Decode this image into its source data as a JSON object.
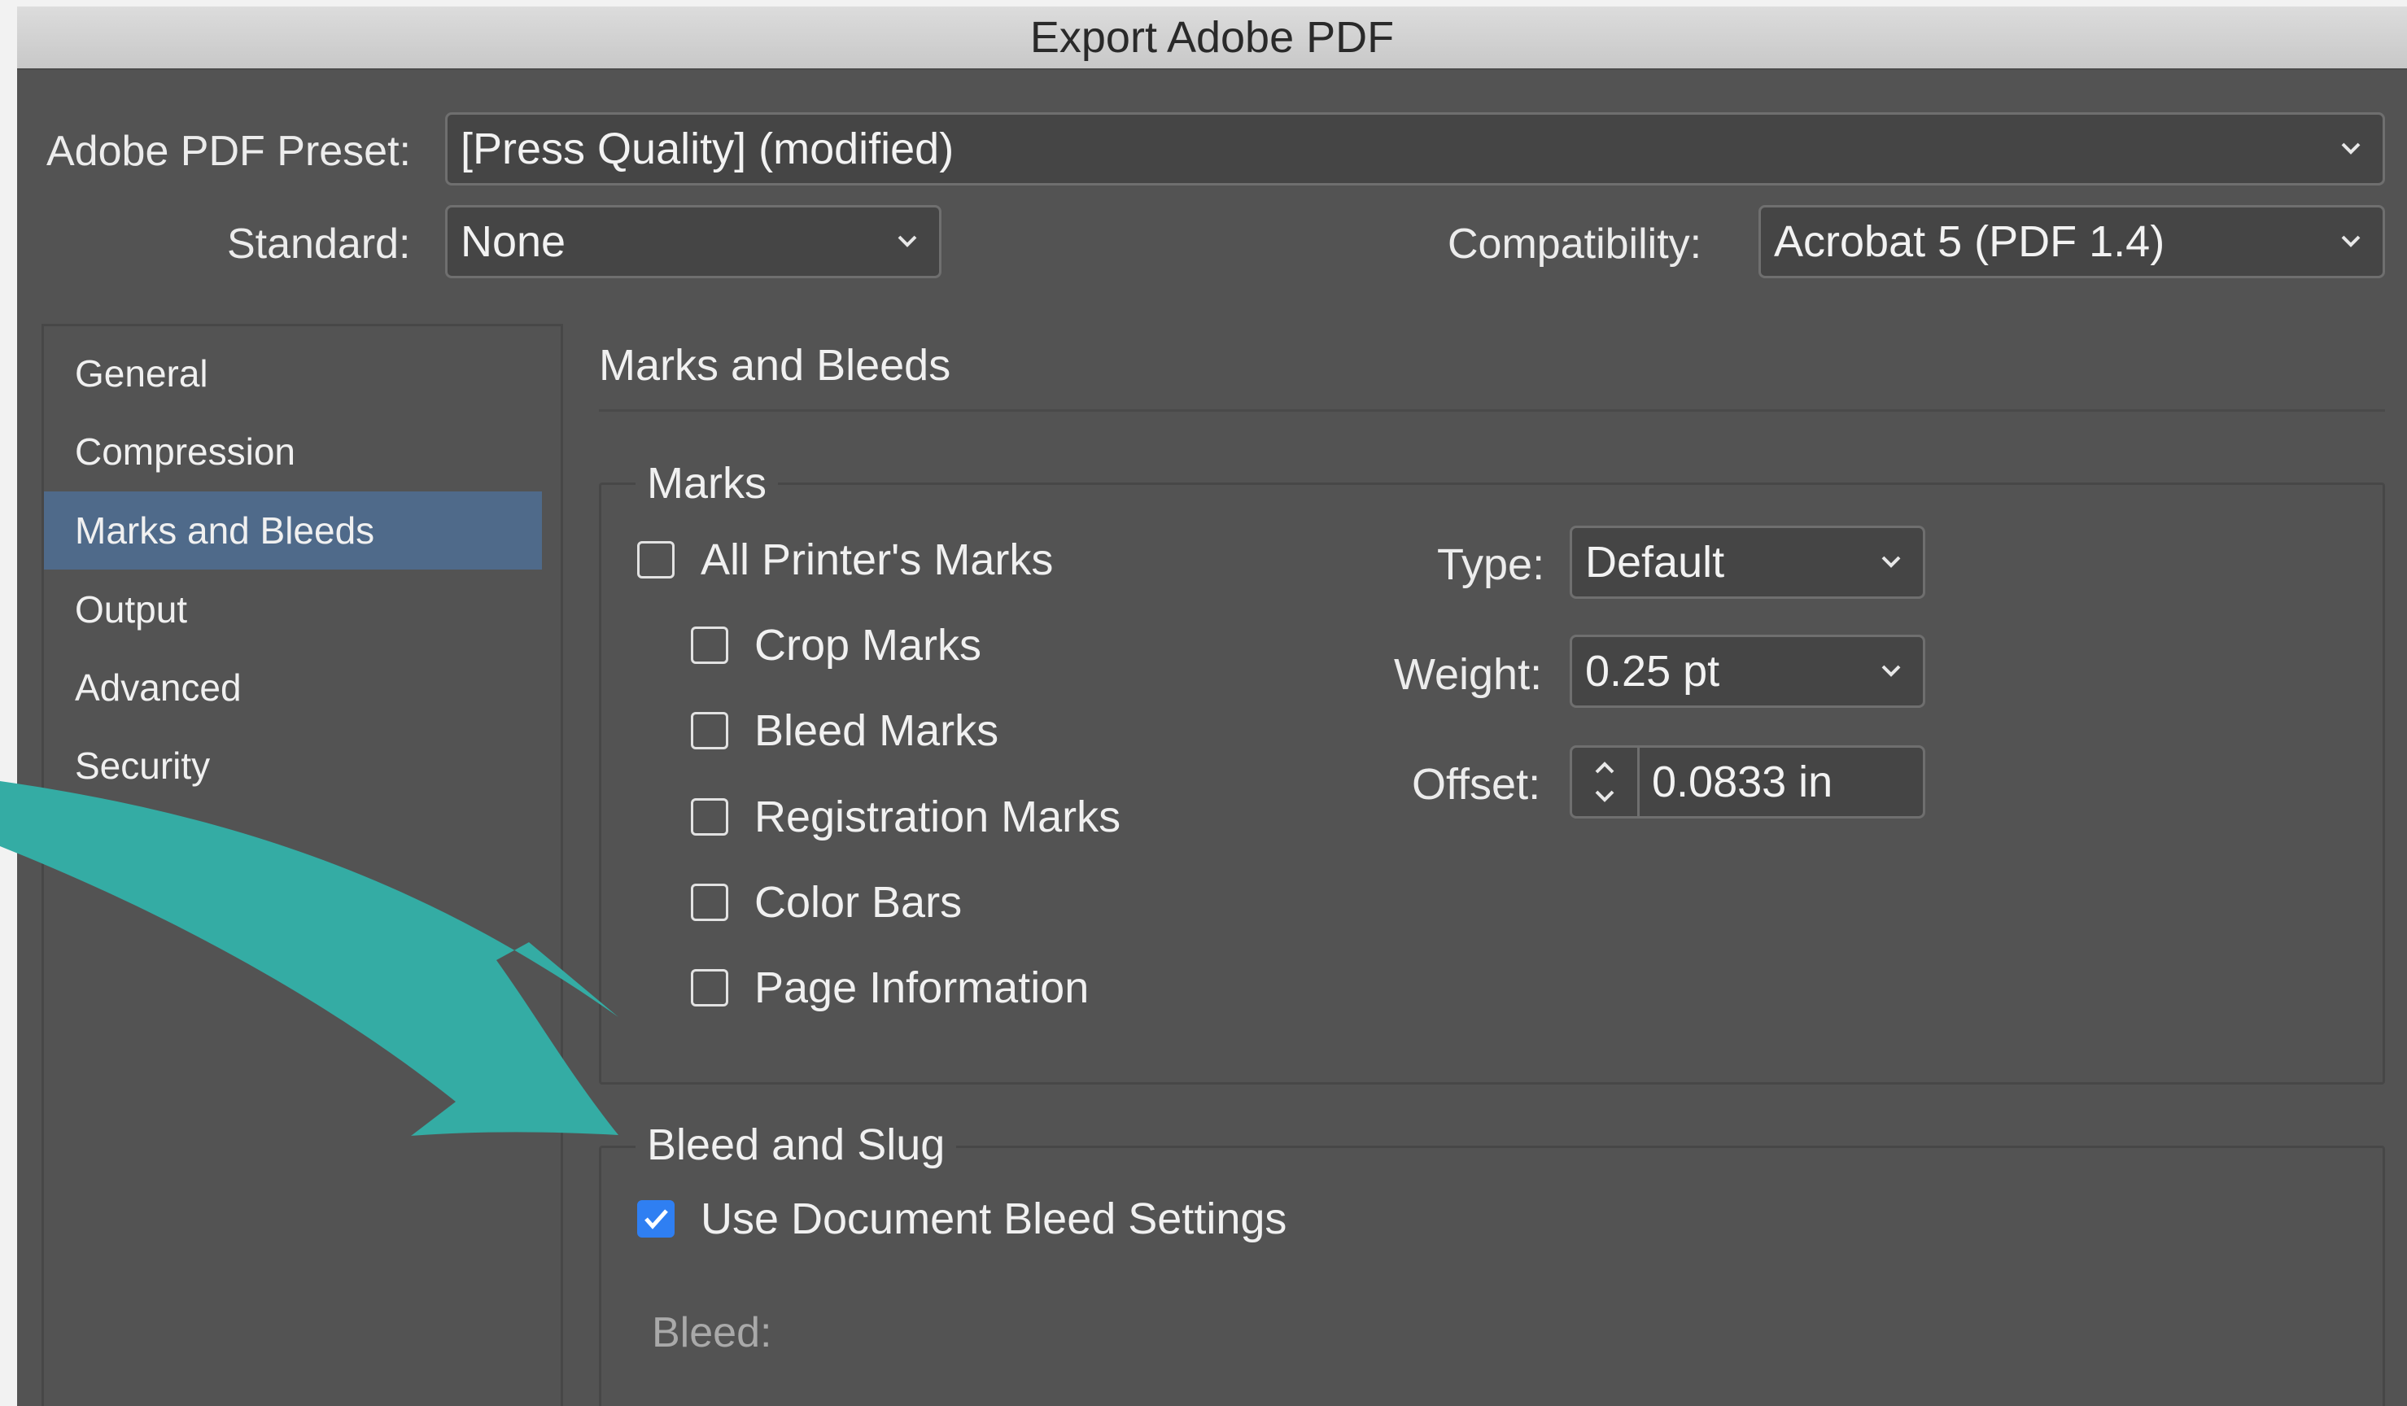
{
  "window": {
    "title": "Export Adobe PDF"
  },
  "preset": {
    "label": "Adobe PDF Preset:",
    "value": "[Press Quality] (modified)"
  },
  "standard": {
    "label": "Standard:",
    "value": "None"
  },
  "compatibility": {
    "label": "Compatibility:",
    "value": "Acrobat 5 (PDF 1.4)"
  },
  "sidebar": {
    "items": [
      {
        "label": "General"
      },
      {
        "label": "Compression"
      },
      {
        "label": "Marks and Bleeds",
        "active": true
      },
      {
        "label": "Output"
      },
      {
        "label": "Advanced"
      },
      {
        "label": "Security"
      }
    ]
  },
  "section": {
    "title": "Marks and Bleeds"
  },
  "marks": {
    "legend": "Marks",
    "all_printers_marks": {
      "label": "All Printer's Marks",
      "checked": false
    },
    "options": [
      {
        "label": "Crop Marks",
        "checked": false
      },
      {
        "label": "Bleed Marks",
        "checked": false
      },
      {
        "label": "Registration Marks",
        "checked": false
      },
      {
        "label": "Color Bars",
        "checked": false
      },
      {
        "label": "Page Information",
        "checked": false
      }
    ],
    "type": {
      "label": "Type:",
      "value": "Default"
    },
    "weight": {
      "label": "Weight:",
      "value": "0.25 pt"
    },
    "offset": {
      "label": "Offset:",
      "value": "0.0833 in"
    }
  },
  "bleed_slug": {
    "legend": "Bleed and Slug",
    "use_document_bleed": {
      "label": "Use Document Bleed Settings",
      "checked": true
    },
    "bleed_label": "Bleed:"
  },
  "colors": {
    "accent_arrow": "#34aca4",
    "checkbox_checked": "#2f7ff2",
    "selected_nav": "#4f6a8a"
  }
}
